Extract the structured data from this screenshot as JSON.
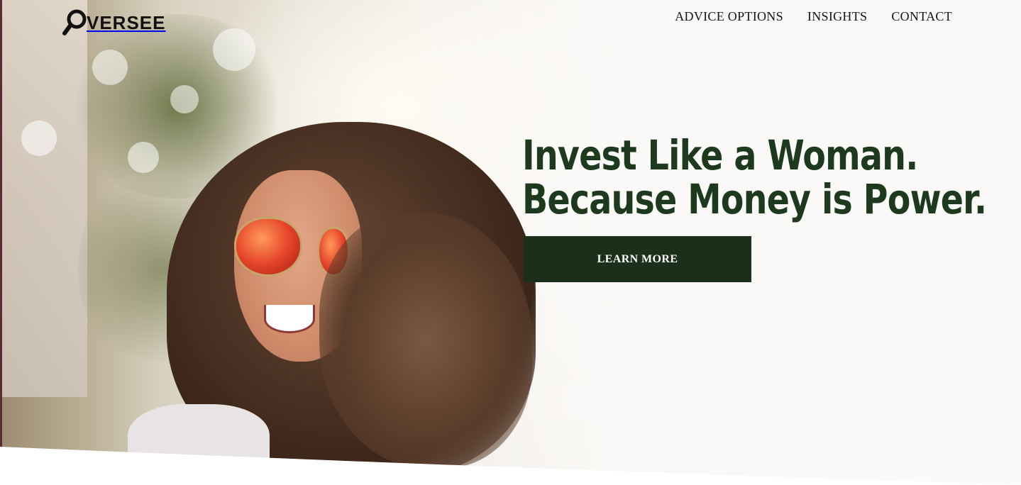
{
  "brand": {
    "name": "VERSEE",
    "logo_icon": "magnifier-o-icon"
  },
  "nav": {
    "items": [
      {
        "label": "ADVICE OPTIONS"
      },
      {
        "label": "INSIGHTS"
      },
      {
        "label": "CONTACT"
      }
    ]
  },
  "hero": {
    "headline_line1": "Invest Like a Woman.",
    "headline_line2": "Because Money is Power.",
    "cta_label": "LEARN MORE"
  },
  "colors": {
    "headline": "#1d3a1e",
    "cta_background": "#1b2f1b",
    "cta_text": "#ffffff",
    "nav_text": "#141414"
  }
}
